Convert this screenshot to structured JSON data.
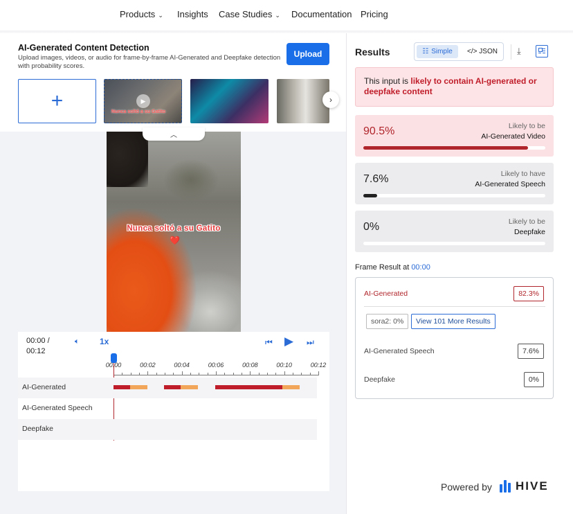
{
  "nav": {
    "items": [
      {
        "label": "Products",
        "has_menu": true
      },
      {
        "label": "Insights",
        "has_menu": false
      },
      {
        "label": "Case Studies",
        "has_menu": true
      },
      {
        "label": "Documentation",
        "has_menu": false
      },
      {
        "label": "Pricing",
        "has_menu": false
      }
    ]
  },
  "detector": {
    "title": "AI-Generated Content Detection",
    "description": "Upload images, videos, or audio for frame-by-frame AI-Generated and Deepfake detection with probability scores.",
    "upload_label": "Upload",
    "add_icon": "+",
    "thumb_caption": "Nunca soltó a su Gatito"
  },
  "video": {
    "caption": "Nunca soltó a su Gatito",
    "heart": "❤️"
  },
  "player": {
    "time_current": "00:00 /",
    "time_total": "00:12",
    "speed": "1x",
    "ticks": [
      "00:00",
      "00:02",
      "00:04",
      "00:06",
      "00:08",
      "00:10",
      "00:12"
    ]
  },
  "tracks": [
    {
      "name": "AI-Generated"
    },
    {
      "name": "AI-Generated Speech"
    },
    {
      "name": "Deepfake"
    }
  ],
  "results": {
    "title": "Results",
    "toggle_simple": "Simple",
    "toggle_json": "</> JSON",
    "alert_prefix": "This input is ",
    "alert_highlight": "likely to contain AI-generated or deepfake content",
    "cards": [
      {
        "value": "90.5%",
        "sub": "Likely to be",
        "label": "AI-Generated Video",
        "fraction": 0.905
      },
      {
        "value": "7.6%",
        "sub": "Likely to have",
        "label": "AI-Generated Speech",
        "fraction": 0.076
      },
      {
        "value": "0%",
        "sub": "Likely to be",
        "label": "Deepfake",
        "fraction": 0.0
      }
    ],
    "frame_title": "Frame Result at ",
    "frame_time": "00:00",
    "frame": {
      "ai_label": "AI-Generated",
      "ai_value": "82.3%",
      "chip_model": "sora2: 0%",
      "chip_more": "View 101 More Results",
      "speech_label": "AI-Generated Speech",
      "speech_value": "7.6%",
      "deepfake_label": "Deepfake",
      "deepfake_value": "0%"
    },
    "powered_by": "Powered by",
    "brand": "HIVE"
  },
  "colors": {
    "accent": "#1a6ee8",
    "danger": "#c01d2a",
    "segment_secondary": "#f2a65a"
  }
}
